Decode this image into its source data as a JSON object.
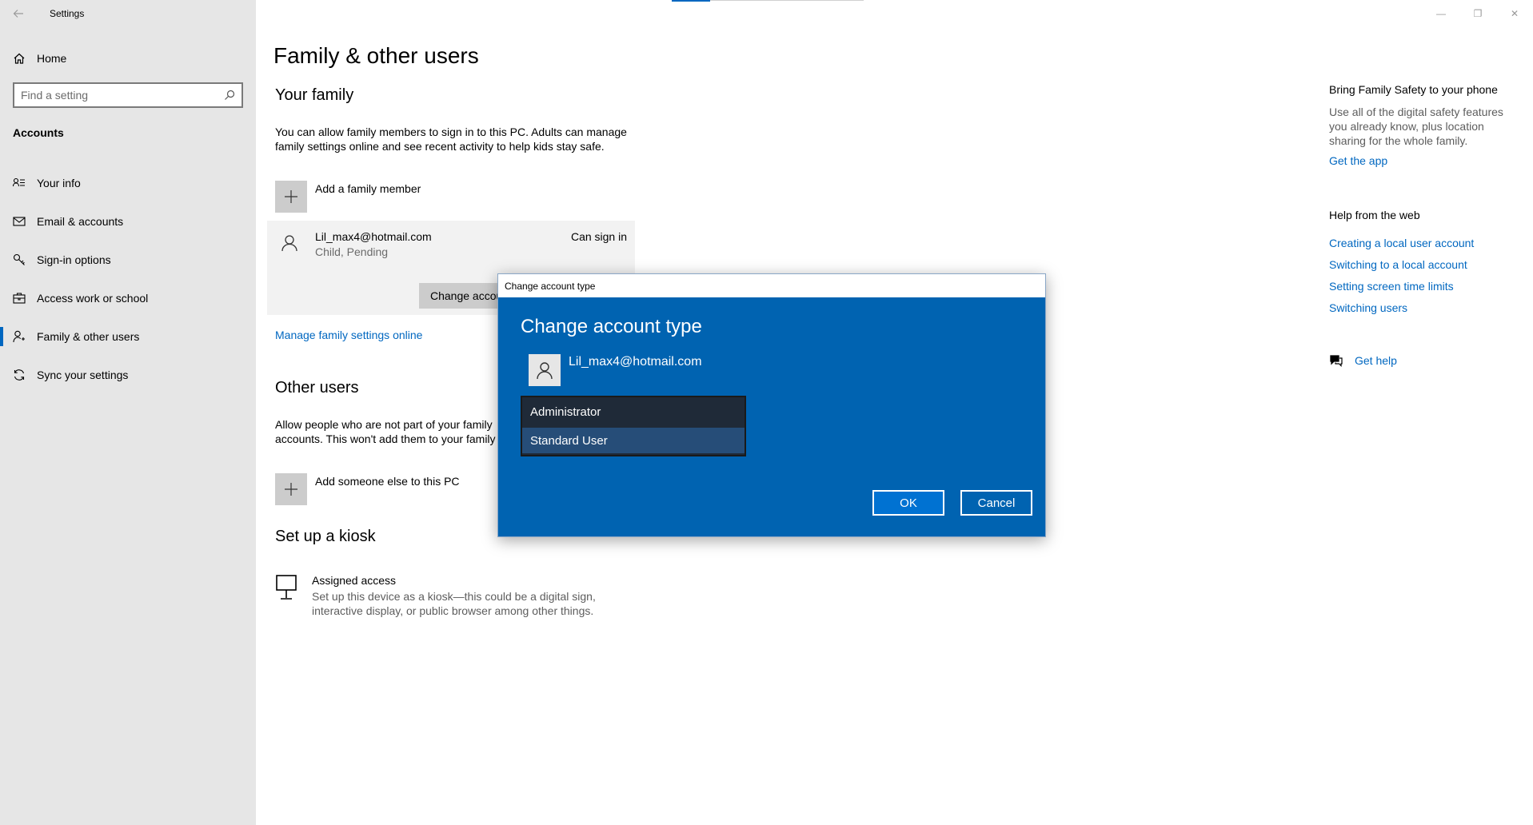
{
  "window": {
    "app_title": "Settings"
  },
  "sidebar": {
    "home_label": "Home",
    "search_placeholder": "Find a setting",
    "section_label": "Accounts",
    "items": [
      {
        "label": "Your info",
        "icon": "person-card-icon"
      },
      {
        "label": "Email & accounts",
        "icon": "mail-icon"
      },
      {
        "label": "Sign-in options",
        "icon": "key-icon"
      },
      {
        "label": "Access work or school",
        "icon": "briefcase-icon"
      },
      {
        "label": "Family & other users",
        "icon": "person-add-icon",
        "active": true
      },
      {
        "label": "Sync your settings",
        "icon": "sync-icon"
      }
    ]
  },
  "main": {
    "page_title": "Family & other users",
    "your_family": {
      "heading": "Your family",
      "description": "You can allow family members to sign in to this PC. Adults can manage family settings online and see recent activity to help kids stay safe.",
      "add_member_label": "Add a family member",
      "member": {
        "email": "Lil_max4@hotmail.com",
        "subtitle": "Child, Pending",
        "status": "Can sign in",
        "change_button_label": "Change account type"
      },
      "manage_link": "Manage family settings online"
    },
    "other_users": {
      "heading": "Other users",
      "description": "Allow people who are not part of your family accounts. This won't add them to your family",
      "add_label": "Add someone else to this PC"
    },
    "kiosk": {
      "heading": "Set up a kiosk",
      "title": "Assigned access",
      "description": "Set up this device as a kiosk—this could be a digital sign, interactive display, or public browser among other things."
    }
  },
  "right_panel": {
    "family_safety_heading": "Bring Family Safety to your phone",
    "family_safety_text": "Use all of the digital safety features you already know, plus location sharing for the whole family.",
    "get_app_link": "Get the app",
    "help_heading": "Help from the web",
    "help_links": [
      "Creating a local user account",
      "Switching to a local account",
      "Setting screen time limits",
      "Switching users"
    ],
    "get_help_label": "Get help"
  },
  "dialog": {
    "titlebar": "Change account type",
    "heading": "Change account type",
    "email": "Lil_max4@hotmail.com",
    "options": [
      "Administrator",
      "Standard User"
    ],
    "selected": "Standard User",
    "ok_label": "OK",
    "cancel_label": "Cancel"
  },
  "colors": {
    "accent": "#0067c0",
    "dialog_bg": "#0063b1",
    "sidebar_bg": "#e6e6e6"
  }
}
